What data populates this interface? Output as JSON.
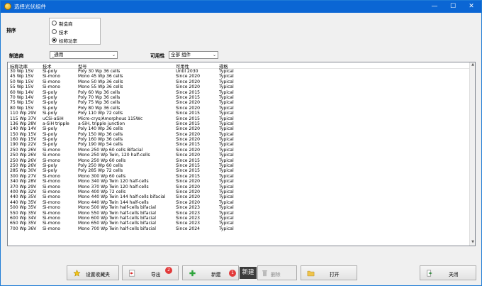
{
  "window": {
    "title": "选择光伏组件",
    "minimize": "—",
    "maximize": "☐",
    "close": "✕"
  },
  "sort": {
    "label": "排序",
    "options": [
      "制造商",
      "技术",
      "标称功率"
    ],
    "selected_index": 2
  },
  "filters": {
    "manufacturer_label": "制造商",
    "manufacturer_value": "_通用",
    "availability_label": "可用性",
    "availability_value": "全部 组件"
  },
  "table": {
    "headers": [
      "标称功率",
      "技术",
      "型号",
      "可用性",
      "规格"
    ],
    "selected_row": 37,
    "rows": [
      [
        "30 Wp 15V",
        "Si-poly",
        "Poly 30 Wp 36 cells",
        "Until 2030",
        "Typical"
      ],
      [
        "45 Wp 15V",
        "Si-mono",
        "Mono 45 Wp 36 cells",
        "Since 2020",
        "Typical"
      ],
      [
        "50 Wp 15V",
        "Si-mono",
        "Mono 50 Wp 36 cells",
        "Since 2020",
        "Typical"
      ],
      [
        "55 Wp 15V",
        "Si-mono",
        "Mono 55 Wp 36 cells",
        "Since 2020",
        "Typical"
      ],
      [
        "60 Wp 14V",
        "Si-poly",
        "Poly 60 Wp  36 cells",
        "Since 2015",
        "Typical"
      ],
      [
        "70 Wp 14V",
        "Si-poly",
        "Poly 70 Wp 36 cells",
        "Since 2015",
        "Typical"
      ],
      [
        "75 Wp 15V",
        "Si-poly",
        "Poly 75 Wp 36 cells",
        "Since 2020",
        "Typical"
      ],
      [
        "80 Wp 15V",
        "Si-poly",
        "Poly 80 Wp 36 cells",
        "Since 2020",
        "Typical"
      ],
      [
        "110 Wp 29V",
        "Si-poly",
        "Poly 110 Wp  72 cells",
        "Since 2015",
        "Typical"
      ],
      [
        "115 Wp 37V",
        "uCSi-aSiH",
        "Micro-crys/Amorphous 115Wc",
        "Since 2015",
        "Typical"
      ],
      [
        "136 Wp 28V",
        "a-SiH tripple",
        "a-SiH, tripple junction",
        "Since 2015",
        "Typical"
      ],
      [
        "140 Wp 14V",
        "Si-poly",
        "Poly 140 Wp 36 cells",
        "Since 2020",
        "Typical"
      ],
      [
        "150 Wp 15V",
        "Si-poly",
        "Poly 150 Wp 36 cells",
        "Since 2020",
        "Typical"
      ],
      [
        "160 Wp 15V",
        "Si-poly",
        "Poly 160 Wp 36 cells",
        "Since 2020",
        "Typical"
      ],
      [
        "190 Wp 22V",
        "Si-poly",
        "Poly 190 Wp  54 cells",
        "Since 2015",
        "Typical"
      ],
      [
        "250 Wp 26V",
        "Si-mono",
        "Mono 250 Wp  60 cells Bifacial",
        "Since 2020",
        "Typical"
      ],
      [
        "250 Wp 26V",
        "Si-mono",
        "Mono 250 Wp  Twin, 120 half-cells",
        "Since 2020",
        "Typical"
      ],
      [
        "250 Wp 26V",
        "Si-mono",
        "Mono 250 Wp  60 cells",
        "Since 2015",
        "Typical"
      ],
      [
        "250 Wp 26V",
        "Si-poly",
        "Poly 250 Wp  60 cells",
        "Since 2015",
        "Typical"
      ],
      [
        "285 Wp 30V",
        "Si-poly",
        "Poly 285 Wp  72 cells",
        "Since 2015",
        "Typical"
      ],
      [
        "300 Wp 27V",
        "Si-mono",
        "Mono 300 Wp 60 cells",
        "Since 2015",
        "Typical"
      ],
      [
        "340 Wp 28V",
        "Si-mono",
        "Mono 340 Wp Twin 120 half-cells",
        "Since 2020",
        "Typical"
      ],
      [
        "370 Wp 29V",
        "Si-mono",
        "Mono 370 Wp Twin 120 half-cells",
        "Since 2020",
        "Typical"
      ],
      [
        "400 Wp 32V",
        "Si-mono",
        "Mono 400 Wp 72 cells",
        "Since 2020",
        "Typical"
      ],
      [
        "440 Wp 35V",
        "Si-mono",
        "Mono 440 Wp Twin 144 half-cells bifacial",
        "Since 2020",
        "Typical"
      ],
      [
        "440 Wp 35V",
        "Si-mono",
        "Mono 440 Wp Twin 144 half-cells",
        "Since 2020",
        "Typical"
      ],
      [
        "500 Wp 35V",
        "Si-mono",
        "Mono 500 Wp Twin half-cells bifacial",
        "Since 2023",
        "Typical"
      ],
      [
        "550 Wp 35V",
        "Si-mono",
        "Mono 550 Wp Twin half-cells bifacial",
        "Since 2023",
        "Typical"
      ],
      [
        "600 Wp 34V",
        "Si-mono",
        "Mono 600 Wp Twin half-cells bifacial",
        "Since 2023",
        "Typical"
      ],
      [
        "650 Wp 35V",
        "Si-mono",
        "Mono 650 Wp Twin half-cells bifacial",
        "Since 2023",
        "Typical"
      ],
      [
        "700 Wp 36V",
        "Si-mono",
        "Mono 700 Wp Twin half-cells bifacial",
        "Since 2024",
        "Typical"
      ]
    ]
  },
  "buttons": {
    "favorites": "设置收藏夹",
    "export": "导出",
    "export_badge": "2",
    "new": "新建",
    "new_badge": "1",
    "new_tooltip": "新建",
    "delete": "删除",
    "open": "打开",
    "close": "关闭"
  }
}
